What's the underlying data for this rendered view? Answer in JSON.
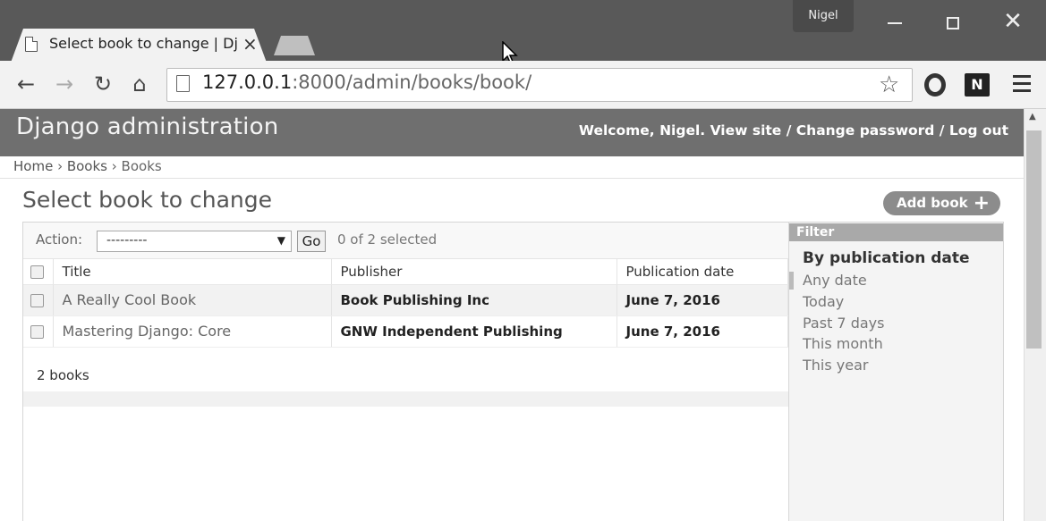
{
  "browser": {
    "tab_title": "Select book to change | Dj",
    "tab_close": "×",
    "user_name": "Nigel",
    "url_host": "127.0.0.1",
    "url_rest": ":8000/admin/books/book/",
    "icons": [
      "back-icon",
      "forward-icon",
      "reload-icon",
      "home-icon",
      "star-icon",
      "opera-icon",
      "onenote-icon",
      "menu-icon"
    ]
  },
  "header": {
    "branding": "Django administration",
    "welcome": "Welcome, Nigel.",
    "view_site": "View site",
    "change_password": "Change password",
    "log_out": "Log out",
    "separator": " / "
  },
  "breadcrumbs": {
    "home": "Home",
    "app": "Books",
    "model": "Books",
    "separator": " › "
  },
  "content": {
    "title": "Select book to change",
    "add_button": "Add book",
    "add_plus": "+"
  },
  "actions": {
    "label": "Action:",
    "select_value": "---------",
    "go": "Go",
    "counter": "0 of 2 selected"
  },
  "table": {
    "headers": {
      "title": "Title",
      "publisher": "Publisher",
      "publication_date": "Publication date"
    },
    "rows": [
      {
        "title": "A Really Cool Book",
        "publisher": "Book Publishing Inc",
        "publication_date": "June 7, 2016"
      },
      {
        "title": "Mastering Django: Core",
        "publisher": "GNW Independent Publishing",
        "publication_date": "June 7, 2016"
      }
    ]
  },
  "paginator": {
    "text": "2 books"
  },
  "filter": {
    "heading": "Filter",
    "title": "By publication date",
    "options": [
      "Any date",
      "Today",
      "Past 7 days",
      "This month",
      "This year"
    ]
  },
  "colors": {
    "header_bg": "#6f6f6f",
    "titlebar_bg": "#595959",
    "add_button_bg": "#8c8c8c"
  }
}
